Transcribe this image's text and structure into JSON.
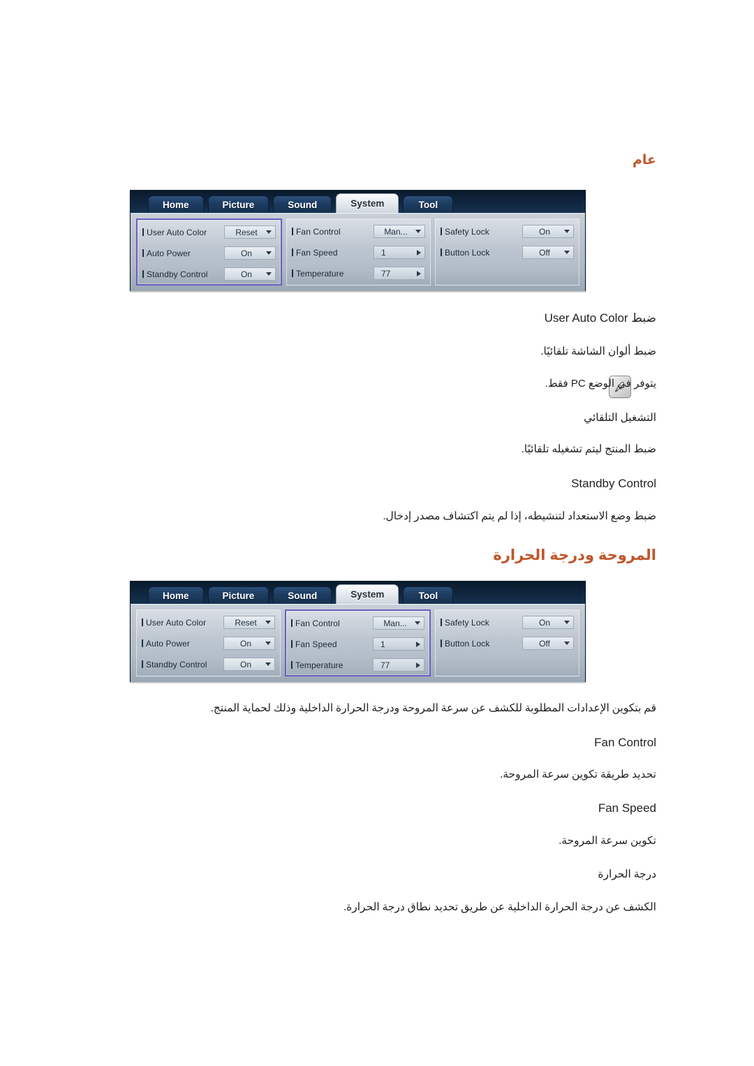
{
  "page": {
    "language": "ar",
    "accent_color": "#c0562a",
    "highlight_color": "#6b5ec0",
    "text_color": "#231f20"
  },
  "sections": [
    {
      "id": "general",
      "title": "عام"
    },
    {
      "id": "fan-temperature",
      "title": "المروحة ودرجة الحرارة"
    }
  ],
  "osd": {
    "tabs": [
      {
        "label": "Home",
        "active": false
      },
      {
        "label": "Picture",
        "active": false
      },
      {
        "label": "Sound",
        "active": false
      },
      {
        "label": "System",
        "active": true
      },
      {
        "label": "Tool",
        "active": false
      }
    ],
    "panels": [
      {
        "id": "panel-general",
        "rows": [
          {
            "label": "User Auto Color",
            "value": "Reset",
            "control": "dropdown"
          },
          {
            "label": "Auto Power",
            "value": "On",
            "control": "dropdown"
          },
          {
            "label": "Standby Control",
            "value": "On",
            "control": "dropdown"
          }
        ]
      },
      {
        "id": "panel-fan",
        "rows": [
          {
            "label": "Fan Control",
            "value": "Man...",
            "control": "dropdown"
          },
          {
            "label": "Fan Speed",
            "value": "1",
            "control": "stepper"
          },
          {
            "label": "Temperature",
            "value": "77",
            "control": "stepper"
          }
        ]
      },
      {
        "id": "panel-lock",
        "rows": [
          {
            "label": "Safety Lock",
            "value": "On",
            "control": "dropdown"
          },
          {
            "label": "Button Lock",
            "value": "Off",
            "control": "dropdown"
          }
        ]
      }
    ],
    "highlight": {
      "first_screenshot_panel": "panel-general",
      "second_screenshot_panel": "panel-fan"
    }
  },
  "general_content": {
    "user_auto_color_heading": "ضبط User Auto Color",
    "user_auto_color_desc": "ضبط ألوان الشاشة تلقائيًا.",
    "note_text": "يتوفر في الوضع PC فقط.",
    "note_icon": "note-pencil-icon",
    "auto_power_heading": "التشغيل التلقائي",
    "auto_power_desc": "ضبط المنتج ليتم تشغيله تلقائيًا.",
    "standby_heading": "Standby Control",
    "standby_desc": "ضبط وضع الاستعداد لتنشيطه، إذا لم يتم اكتشاف مصدر إدخال."
  },
  "fan_content": {
    "intro": "قم بتكوين الإعدادات المطلوبة للكشف عن سرعة المروحة ودرجة الحرارة الداخلية وذلك لحماية المنتج.",
    "fan_control_heading": "Fan Control",
    "fan_control_desc": "تحديد طريقة تكوين سرعة المروحة.",
    "fan_speed_heading": "Fan Speed",
    "fan_speed_desc": "تكوين سرعة المروحة.",
    "temperature_heading": "درجة الحرارة",
    "temperature_desc": "الكشف عن درجة الحرارة الداخلية عن طريق تحديد نطاق درجة الحرارة."
  }
}
